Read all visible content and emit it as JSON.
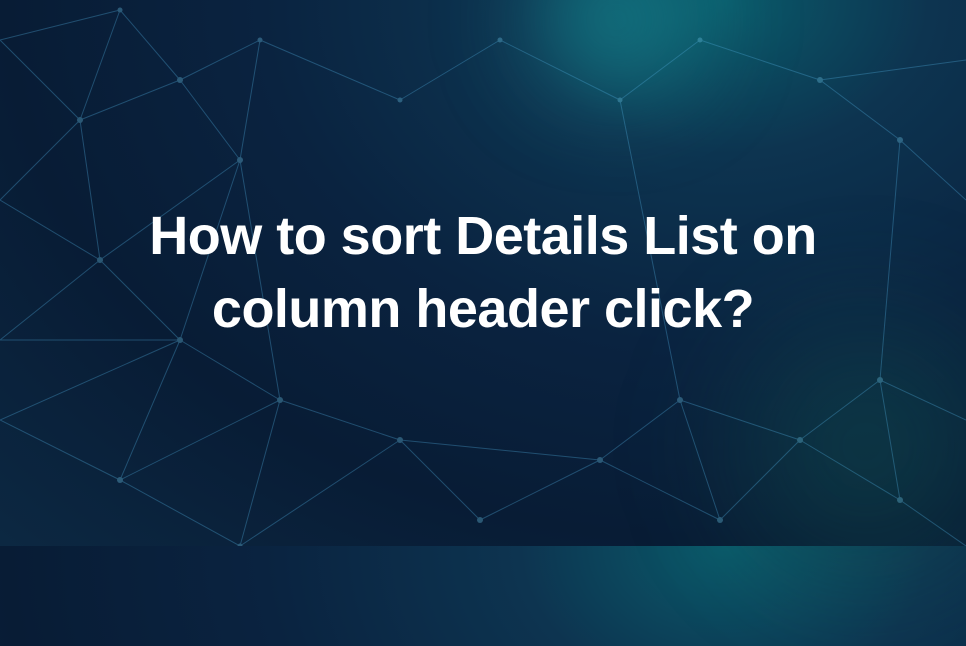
{
  "title": "How to sort Details List on column header click?"
}
